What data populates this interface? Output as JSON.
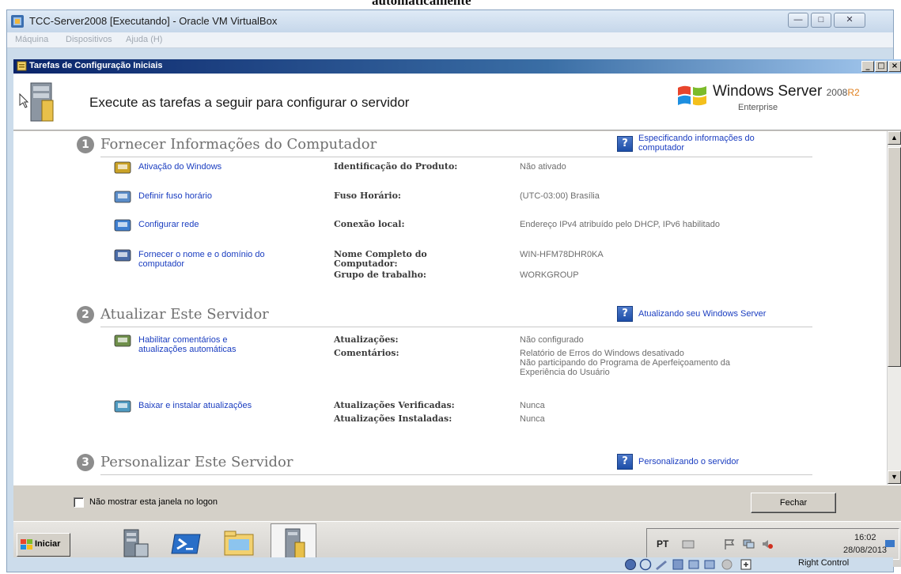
{
  "top_caption": "automaticamente",
  "host_window": {
    "title": "TCC-Server2008 [Executando] - Oracle VM VirtualBox",
    "menu": [
      "Máquina",
      "Dispositivos",
      "Ajuda (H)"
    ],
    "status_host_key": "Right Control"
  },
  "dialog": {
    "title": "Tarefas de Configuração Iniciais",
    "header_text": "Execute as tarefas a seguir para configurar o servidor",
    "brand": {
      "name": "Windows Server",
      "version": "2008",
      "release": "R2",
      "edition": "Enterprise"
    }
  },
  "sections": [
    {
      "number": "1",
      "title": "Fornecer Informações do Computador",
      "help_link": [
        "Especificando informações do",
        "computador"
      ],
      "tasks": [
        {
          "link": [
            "Ativação do Windows"
          ],
          "icon": "key-icon",
          "props": [
            {
              "label": [
                "Identificação do Produto:"
              ],
              "values": [
                "Não ativado"
              ]
            }
          ]
        },
        {
          "link": [
            "Definir fuso horário"
          ],
          "icon": "clock-icon",
          "props": [
            {
              "label": [
                "Fuso Horário:"
              ],
              "values": [
                "(UTC-03:00) Brasília"
              ]
            }
          ]
        },
        {
          "link": [
            "Configurar rede"
          ],
          "icon": "network-icon",
          "props": [
            {
              "label": [
                "Conexão local:"
              ],
              "values": [
                "Endereço IPv4 atribuído pelo DHCP, IPv6 habilitado"
              ]
            }
          ]
        },
        {
          "link": [
            "Fornecer o nome e o domínio do",
            "computador"
          ],
          "icon": "computer-icon",
          "props": [
            {
              "label": [
                "Nome Completo do",
                "Computador:"
              ],
              "values": [
                "WIN-HFM78DHR0KA"
              ]
            },
            {
              "label": [
                "Grupo de trabalho:"
              ],
              "values": [
                "WORKGROUP"
              ]
            }
          ]
        }
      ]
    },
    {
      "number": "2",
      "title": "Atualizar Este Servidor",
      "help_link": [
        "Atualizando seu Windows Server"
      ],
      "tasks": [
        {
          "link": [
            "Habilitar comentários e",
            "atualizações automáticas"
          ],
          "icon": "users-icon",
          "props": [
            {
              "label": [
                "Atualizações:"
              ],
              "values": [
                "Não configurado"
              ]
            },
            {
              "label": [
                "Comentários:"
              ],
              "values": [
                "Relatório de Erros do Windows desativado",
                "Não participando do Programa de Aperfeiçoamento da",
                "Experiência do Usuário"
              ]
            }
          ]
        },
        {
          "link": [
            "Baixar e instalar atualizações"
          ],
          "icon": "update-icon",
          "props": [
            {
              "label": [
                "Atualizações Verificadas:"
              ],
              "values": [
                "Nunca"
              ]
            },
            {
              "label": [
                "Atualizações Instaladas:"
              ],
              "values": [
                "Nunca"
              ]
            }
          ]
        }
      ]
    },
    {
      "number": "3",
      "title": "Personalizar Este Servidor",
      "help_link": [
        "Personalizando o servidor"
      ],
      "tasks": []
    }
  ],
  "footer": {
    "checkbox_label": "Não mostrar esta janela no logon",
    "checkbox_checked": false,
    "close_label": "Fechar"
  },
  "taskbar": {
    "start_label": "Iniciar",
    "apps": [
      "server-manager-icon",
      "powershell-icon",
      "explorer-icon",
      "initial-config-tasks-icon"
    ],
    "language": "PT",
    "time": "16:02",
    "date": "28/08/2013"
  },
  "colors": {
    "link": "#1a3dc0",
    "dialog_title": "#0a246a",
    "r2_accent": "#e08020"
  }
}
